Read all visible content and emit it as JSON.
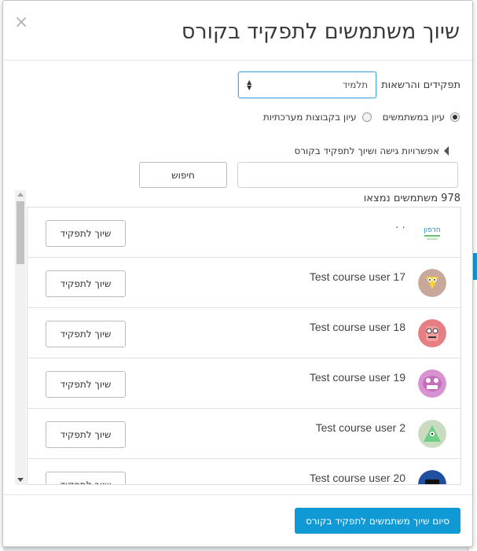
{
  "modal": {
    "title": "שיוך משתמשים לתפקיד בקורס",
    "close_label": "×"
  },
  "role_select": {
    "label": "תפקידים והרשאות",
    "selected": "תלמיד"
  },
  "view_options": {
    "users_label": "עיון במשתמשים",
    "cohorts_label": "עיון בקבוצות מערכתיות",
    "selected": "users"
  },
  "access_options": {
    "label": "אפשרויות גישה ושיוך לתפקיד בקורס"
  },
  "search": {
    "placeholder": "",
    "button_label": "חיפוש"
  },
  "results": {
    "count_text": "978 משתמשים נמצאו"
  },
  "users": [
    {
      "name": "· ·",
      "avatar": "logo-icon",
      "button_label": "שיוך לתפקיד"
    },
    {
      "name": "Test course user 17",
      "avatar": "avatar-monster-yellow",
      "button_label": "שיוך לתפקיד"
    },
    {
      "name": "Test course user 18",
      "avatar": "avatar-monster-red",
      "button_label": "שיוך לתפקיד"
    },
    {
      "name": "Test course user 19",
      "avatar": "avatar-monster-purple",
      "button_label": "שיוך לתפקיד"
    },
    {
      "name": "Test course user 2",
      "avatar": "avatar-monster-green",
      "button_label": "שיוך לתפקיד"
    },
    {
      "name": "Test course user 20",
      "avatar": "avatar-monster-blue",
      "button_label": "שיוך לתפקיד"
    }
  ],
  "footer": {
    "finish_label": "סיום שיוך משתמשים לתפקיד בקורס"
  },
  "colors": {
    "primary": "#0f9ad6",
    "focus_border": "#4ea6dd"
  }
}
